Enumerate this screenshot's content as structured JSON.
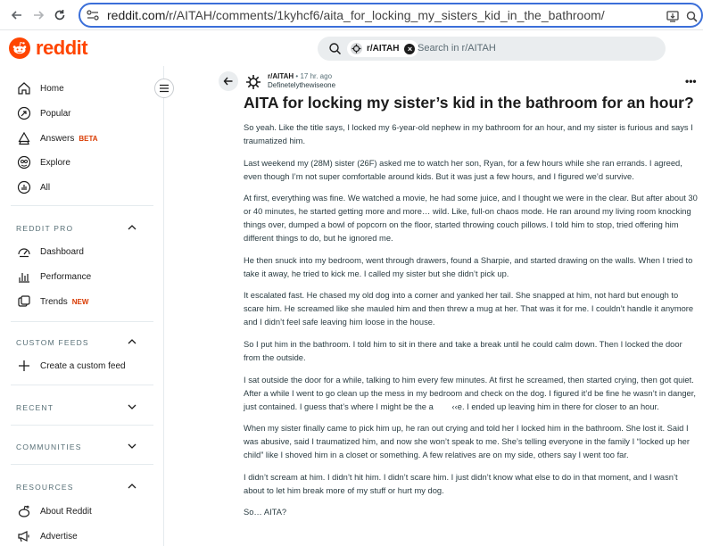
{
  "browser": {
    "url_host": "reddit.com",
    "url_path": "/r/AITAH/comments/1kyhcf6/aita_for_locking_my_sisters_kid_in_the_bathroom/"
  },
  "header": {
    "logo_text": "reddit",
    "search": {
      "chip_label": "r/AITAH",
      "placeholder": "Search in r/AITAH"
    }
  },
  "sidebar": {
    "main_items": [
      {
        "label": "Home",
        "icon": "home-icon"
      },
      {
        "label": "Popular",
        "icon": "popular-icon"
      },
      {
        "label": "Answers",
        "icon": "answers-icon",
        "badge": "BETA"
      },
      {
        "label": "Explore",
        "icon": "explore-icon"
      },
      {
        "label": "All",
        "icon": "all-icon"
      }
    ],
    "reddit_pro": {
      "title": "REDDIT PRO",
      "items": [
        {
          "label": "Dashboard",
          "icon": "dashboard-icon"
        },
        {
          "label": "Performance",
          "icon": "performance-icon"
        },
        {
          "label": "Trends",
          "icon": "trends-icon",
          "badge": "NEW"
        }
      ]
    },
    "custom_feeds": {
      "title": "CUSTOM FEEDS",
      "items": [
        {
          "label": "Create a custom feed",
          "icon": "plus-icon"
        }
      ]
    },
    "recent": {
      "title": "RECENT"
    },
    "communities": {
      "title": "COMMUNITIES"
    },
    "resources": {
      "title": "RESOURCES",
      "items": [
        {
          "label": "About Reddit",
          "icon": "about-reddit-icon"
        },
        {
          "label": "Advertise",
          "icon": "advertise-icon"
        }
      ]
    }
  },
  "post": {
    "subreddit": "r/AITAH",
    "time": "• 17 hr. ago",
    "author": "Definetelythewiseone",
    "title": "AITA for locking my sister’s kid in the bathroom for an hour?",
    "paragraphs": [
      "So yeah. Like the title says, I locked my 6-year-old nephew in my bathroom for an hour, and my sister is furious and says I traumatized him.",
      "Last weekend my (28M) sister (26F) asked me to watch her son, Ryan, for a few hours while she ran errands. I agreed, even though I’m not super comfortable around kids. But it was just a few hours, and I figured we’d survive.",
      "At first, everything was fine. We watched a movie, he had some juice, and I thought we were in the clear. But after about 30 or 40 minutes, he started getting more and more… wild. Like, full-on chaos mode. He ran around my living room knocking things over, dumped a bowl of popcorn on the floor, started throwing couch pillows. I told him to stop, tried offering him different things to do, but he ignored me.",
      "He then snuck into my bedroom, went through drawers, found a Sharpie, and started drawing on the walls. When I tried to take it away, he tried to kick me. I called my sister but she didn’t pick up.",
      "It escalated fast. He chased my old dog into a corner and yanked her tail. She snapped at him, not hard but enough to scare him. He screamed like she mauled him and then threw a mug at her. That was it for me. I couldn’t handle it anymore and I didn’t feel safe leaving him loose in the house.",
      "So I put him in the bathroom. I told him to sit in there and take a break until he could calm down. Then I locked the door from the outside.",
      "I sat outside the door for a while, talking to him every few minutes. At first he screamed, then started crying, then got quiet. After a while I went to go clean up the mess in my bedroom and check on the dog. I figured it’d be fine he wasn’t in danger, just contained. I guess that’s where I might be the a        ‹‹e. I ended up leaving him in there for closer to an hour.",
      "When my sister finally came to pick him up, he ran out crying and told her I locked him in the bathroom. She lost it. Said I was abusive, said I traumatized him, and now she won’t speak to me. She’s telling everyone in the family I “locked up her child” like I shoved him in a closet or something. A few relatives are on my side, others say I went too far.",
      "I didn’t scream at him. I didn’t hit him. I didn’t scare him. I just didn’t know what else to do in that moment, and I wasn’t about to let him break more of my stuff or hurt my dog.",
      "So… AITA?"
    ]
  }
}
